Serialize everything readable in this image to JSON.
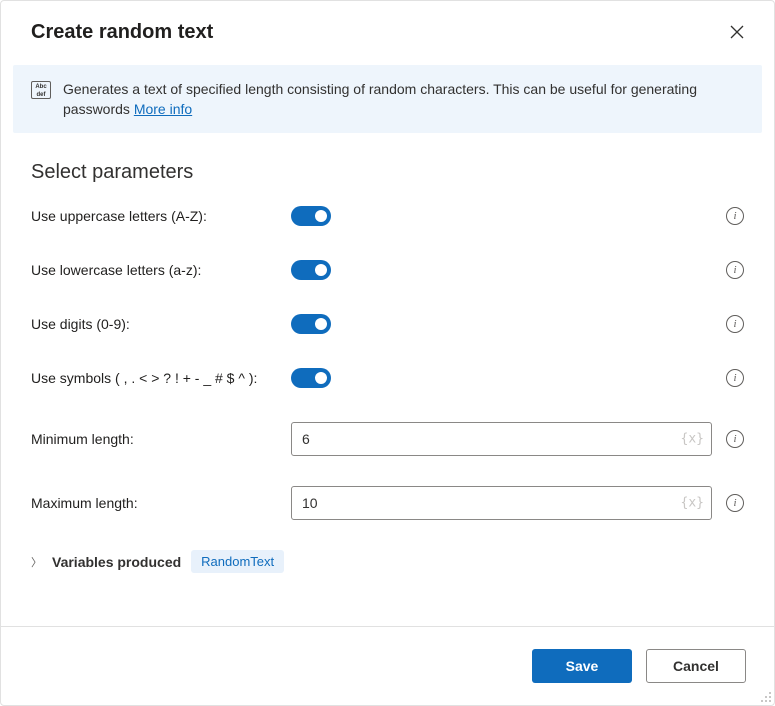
{
  "dialog": {
    "title": "Create random text",
    "description": "Generates a text of specified length consisting of random characters. This can be useful for generating passwords ",
    "more_info": "More info"
  },
  "section_title": "Select parameters",
  "params": {
    "uppercase_label": "Use uppercase letters (A-Z):",
    "lowercase_label": "Use lowercase letters (a-z):",
    "digits_label": "Use digits (0-9):",
    "symbols_label": "Use symbols ( , . < > ? ! + - _ # $ ^ ):",
    "min_length_label": "Minimum length:",
    "min_length_value": "6",
    "max_length_label": "Maximum length:",
    "max_length_value": "10"
  },
  "variables": {
    "label": "Variables produced",
    "tag": "RandomText"
  },
  "footer": {
    "save": "Save",
    "cancel": "Cancel"
  },
  "icons": {
    "var_token": "{x}"
  }
}
